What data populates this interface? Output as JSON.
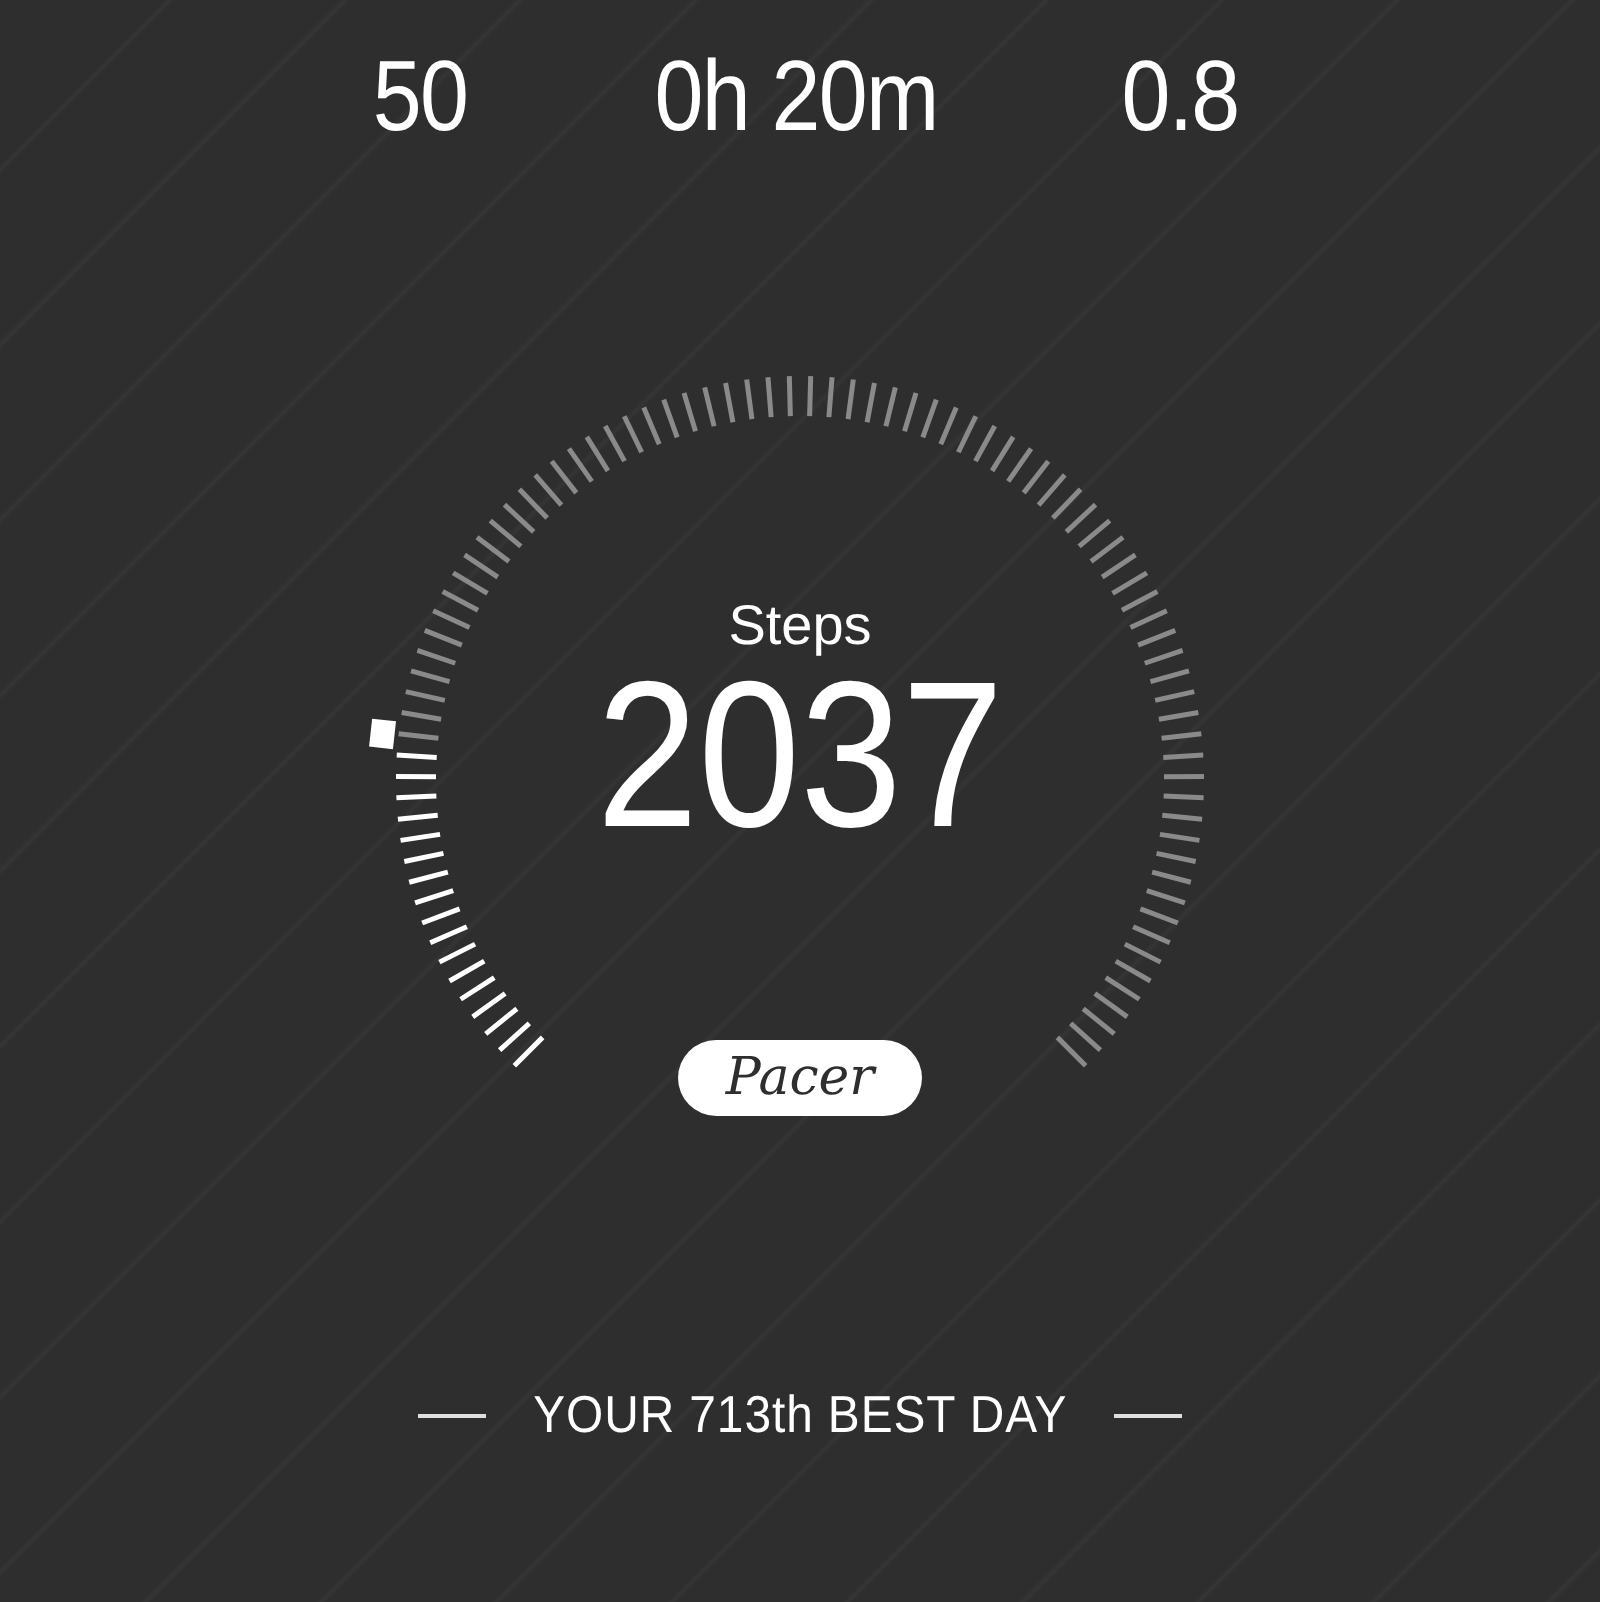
{
  "stats": [
    {
      "value": "50"
    },
    {
      "value": "0h 20m"
    },
    {
      "value": "0.8"
    }
  ],
  "gauge": {
    "label": "Steps",
    "value": "2037"
  },
  "brand": "Pacer",
  "rank": "YOUR 713th BEST DAY"
}
